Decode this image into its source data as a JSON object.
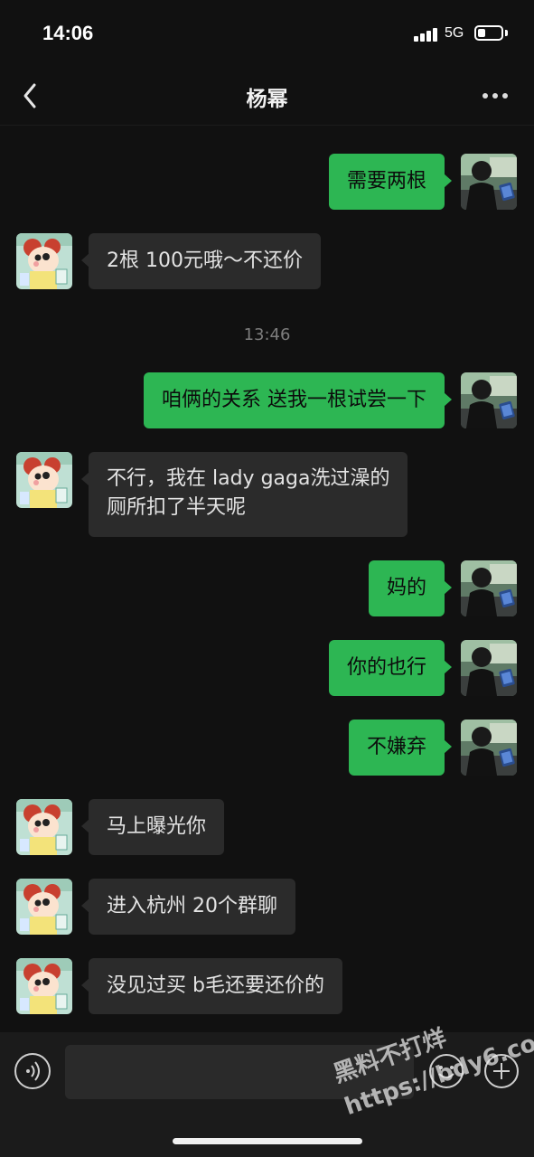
{
  "status": {
    "time": "14:06",
    "network": "5G",
    "battery_level": 0.35
  },
  "header": {
    "title": "杨幂"
  },
  "messages": [
    {
      "side": "out",
      "text": "需要两根"
    },
    {
      "side": "in",
      "text": "2根 100元哦～不还价"
    },
    {
      "timestamp": "13:46"
    },
    {
      "side": "out",
      "text": "咱俩的关系 送我一根试尝一下"
    },
    {
      "side": "in",
      "lines": [
        "不行，我在 lady gaga洗过澡的",
        "厕所扣了半天呢"
      ]
    },
    {
      "side": "out",
      "text": "妈的"
    },
    {
      "side": "out",
      "text": "你的也行"
    },
    {
      "side": "out",
      "text": "不嫌弃"
    },
    {
      "side": "in",
      "text": "马上曝光你"
    },
    {
      "side": "in",
      "text": "进入杭州 20个群聊"
    },
    {
      "side": "in",
      "text": "没见过买 b毛还要还价的"
    }
  ],
  "input": {
    "value": "",
    "placeholder": ""
  },
  "icons": {
    "back": "chevron-left-icon",
    "more": "more-dots-icon",
    "voice": "voice-icon",
    "emoji": "emoji-icon",
    "plus": "plus-icon"
  },
  "watermark": {
    "line1": "黑料不打烊",
    "line2": "https://bdy6.co"
  },
  "colors": {
    "sent_bubble": "#2db653",
    "received_bubble": "#2b2b2b",
    "background": "#111111"
  }
}
